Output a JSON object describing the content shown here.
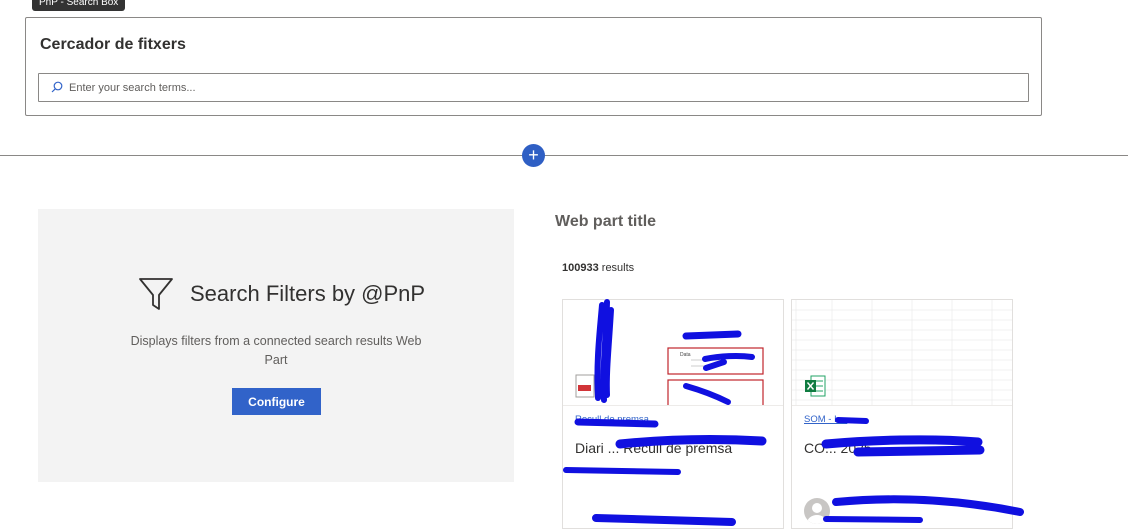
{
  "searchbox_webpart": {
    "tag": "PnP - Search Box",
    "title": "Cercador de fitxers",
    "search_placeholder": "Enter your search terms..."
  },
  "section": {
    "add_button": "+"
  },
  "filters_webpart": {
    "title": "Search Filters by @PnP",
    "description": "Displays filters from a connected search results Web Part",
    "configure_label": "Configure",
    "icon": "filter-icon"
  },
  "results_webpart": {
    "title": "Web part title",
    "count": "100933",
    "count_suffix": "results",
    "cards": [
      {
        "site": "Recull de premsa",
        "title": "Diari ... Recull de premsa",
        "file_icon": "pdf-icon",
        "thumb_label": "Data"
      },
      {
        "site": "SOM - L...",
        "title": "CO... 2025",
        "file_icon": "excel-icon",
        "author": ""
      }
    ]
  },
  "colors": {
    "accent": "#3163c9",
    "border": "#8a8886",
    "panel": "#f3f3f3",
    "redaction": "#1010e0"
  }
}
